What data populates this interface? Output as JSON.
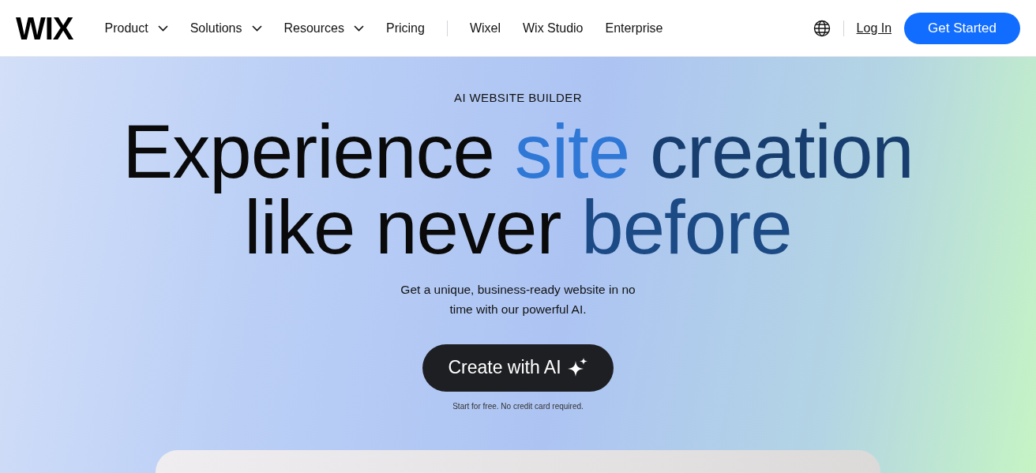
{
  "header": {
    "logo": "WIX",
    "nav": [
      {
        "label": "Product",
        "kind": "dropdown"
      },
      {
        "label": "Solutions",
        "kind": "dropdown"
      },
      {
        "label": "Resources",
        "kind": "dropdown"
      },
      {
        "label": "Pricing",
        "kind": "link"
      },
      {
        "kind": "divider"
      },
      {
        "label": "Wixel",
        "kind": "link"
      },
      {
        "label": "Wix Studio",
        "kind": "link"
      },
      {
        "label": "Enterprise",
        "kind": "link"
      }
    ],
    "login": "Log In",
    "cta": "Get Started"
  },
  "hero": {
    "eyebrow": "AI WEBSITE BUILDER",
    "headline": [
      [
        {
          "text": "Experience ",
          "color": "#0a0a0a"
        },
        {
          "text": "site",
          "color": "#2f78d6"
        },
        {
          "text": " creation",
          "color": "#173e6e"
        }
      ],
      [
        {
          "text": "like never ",
          "color": "#0a0a0a"
        },
        {
          "text": "before",
          "color": "#1c4a85"
        }
      ]
    ],
    "subtitle": "Get a unique, business-ready website in no time with our powerful AI.",
    "button": "Create with AI",
    "note": "Start for free. No credit card required."
  }
}
